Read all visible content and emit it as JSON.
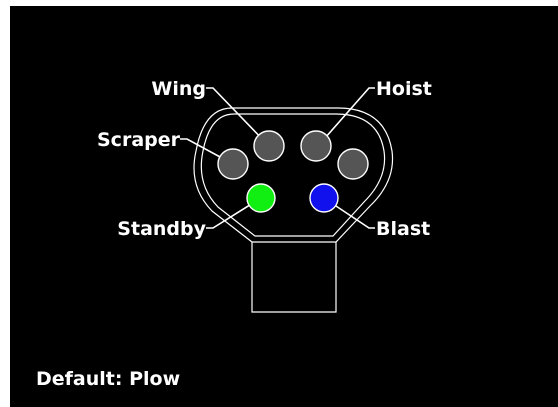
{
  "labels": {
    "wing": "Wing",
    "hoist": "Hoist",
    "scraper": "Scraper",
    "standby": "Standby",
    "blast": "Blast"
  },
  "footer": {
    "default_text": "Default: Plow"
  },
  "buttons": {
    "wing": {
      "state": "off",
      "color": "#555555"
    },
    "hoist": {
      "state": "off",
      "color": "#555555"
    },
    "scraper": {
      "state": "off",
      "color": "#555555"
    },
    "extra": {
      "state": "off",
      "color": "#555555"
    },
    "standby": {
      "state": "on",
      "color": "#11ee11"
    },
    "blast": {
      "state": "on",
      "color": "#1111ee"
    }
  },
  "colors": {
    "background": "#000000",
    "outline": "#ffffff",
    "text": "#ffffff"
  }
}
